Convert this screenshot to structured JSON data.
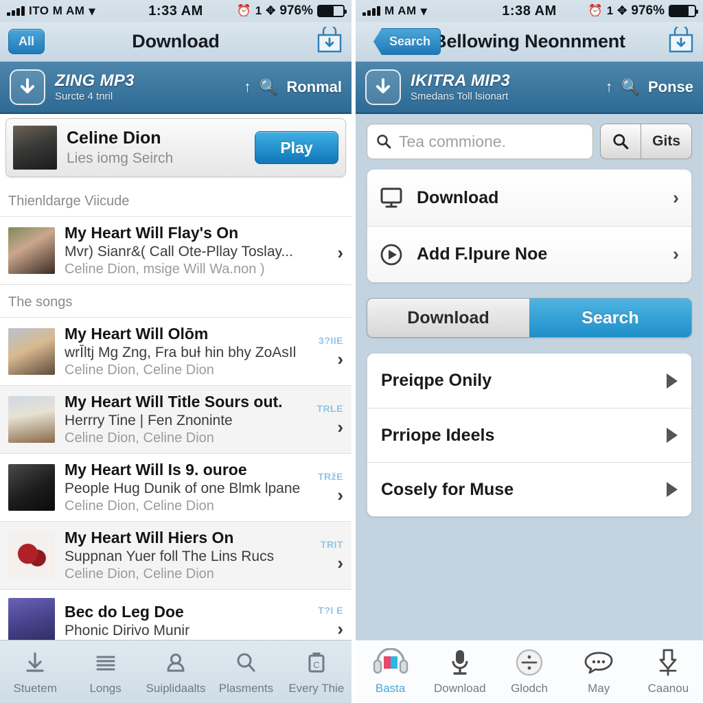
{
  "left": {
    "status": {
      "carrier": "ITO M AM",
      "wifi_icon": "wifi-icon",
      "time": "1:33 AM",
      "alarm_icon": "alarm-icon",
      "count": "1",
      "bluetooth_icon": "bluetooth-icon",
      "battery_pct": "976%"
    },
    "nav": {
      "left_button": "All",
      "title": "Download",
      "right_icon": "download-bag-icon"
    },
    "appbar": {
      "icon": "download-arrow-icon",
      "title": "ZING MP3",
      "subtitle": "Surcte 4 tnril",
      "upload_icon": "upload-icon",
      "search_icon": "search-icon",
      "action": "Ronmal"
    },
    "artist_card": {
      "name": "Celine Dion",
      "subtitle": "Lies iomg Seirch",
      "button": "Play"
    },
    "sections": [
      {
        "header": "Thienldarge Viicude",
        "rows": [
          {
            "title": "My Heart Will Flay's On",
            "subtitle": "Mvr) Sianr&( Call Ote-Pllay Toslay...",
            "artist": "Celine Dion, msige Will Wa.non )",
            "badge": "",
            "thumb": "t2"
          }
        ]
      },
      {
        "header": "The songs",
        "rows": [
          {
            "title": "My Heart Will Olōm",
            "subtitle": "wrĪltj Mg Zng, Fra buƗ hin bhy ZoAsIl",
            "artist": "Celine Dion, Celine Dion",
            "badge": "3?IІE",
            "thumb": "t3"
          },
          {
            "title": "My Heart Will Title Sours out.",
            "subtitle": "Herrry Tine | Fen Znoninte",
            "artist": "Celine Dion, Celine Dion",
            "badge": "TRLE",
            "thumb": "t4"
          },
          {
            "title": "My Heart Will Is 9. ouroe",
            "subtitle": "People Hug Dunik of one Blmk lpane",
            "artist": "Celine Dion, Celine Dion",
            "badge": "TRžE",
            "thumb": "t5"
          },
          {
            "title": "My Heart Will Hiers On",
            "subtitle": "Suppnan Yuer foll The Lins Rucs",
            "artist": "Celine Dion, Celine Dion",
            "badge": "TRІT",
            "thumb": "t6"
          },
          {
            "title": "Bec do Leg Doe",
            "subtitle": "Phonic Dirivo Munir",
            "artist": "",
            "badge": "T?I E",
            "thumb": "t7"
          }
        ]
      }
    ],
    "tabs": [
      {
        "label": "Stuetem",
        "icon": "download-icon",
        "active": false
      },
      {
        "label": "Longs",
        "icon": "list-icon",
        "active": false
      },
      {
        "label": "Suiplidaalts",
        "icon": "person-icon",
        "active": false
      },
      {
        "label": "Plasments",
        "icon": "search-icon",
        "active": false
      },
      {
        "label": "Every Thie",
        "icon": "clipboard-c-icon",
        "active": false
      }
    ]
  },
  "right": {
    "status": {
      "carrier": "M AM",
      "wifi_icon": "wifi-icon",
      "time": "1:38 AM",
      "alarm_icon": "alarm-icon",
      "count": "1",
      "bluetooth_icon": "bluetooth-icon",
      "battery_pct": "976%"
    },
    "nav": {
      "back_button": "Search",
      "title": "Bellowing Neonnment",
      "right_icon": "download-bag-icon"
    },
    "appbar": {
      "icon": "download-arrow-icon",
      "title": "IKITRA MIP3",
      "subtitle": "Smedans Toll lsionart",
      "upload_icon": "upload-icon",
      "search_icon": "search-icon",
      "action": "Ponse"
    },
    "search": {
      "placeholder": "Tea commione.",
      "icon": "search-icon",
      "button_icon": "search-icon",
      "button_label": "Gits"
    },
    "menu": [
      {
        "label": "Download",
        "icon": "monitor-icon"
      },
      {
        "label": "Add F.lpure Noe",
        "icon": "play-circle-icon"
      }
    ],
    "segmented": {
      "options": [
        "Download",
        "Search"
      ],
      "selected": "Search"
    },
    "list": [
      {
        "label": "Preiqpe Onily"
      },
      {
        "label": "Prriope Ideels"
      },
      {
        "label": "Cosely for Muse"
      }
    ],
    "tabs": [
      {
        "label": "Basta",
        "icon": "headphones-icon",
        "active": true
      },
      {
        "label": "Download",
        "icon": "microphone-icon",
        "active": false
      },
      {
        "label": "Glodch",
        "icon": "divide-circle-icon",
        "active": false
      },
      {
        "label": "May",
        "icon": "chat-bubble-icon",
        "active": false
      },
      {
        "label": "Caanou",
        "icon": "download-arrow-icon",
        "active": false
      }
    ]
  },
  "colors": {
    "accent_blue": "#1f8fc9",
    "appbar_blue": "#2d6a94",
    "badge_blue": "#8fc4e4",
    "right_bg": "#c3d3e0"
  }
}
